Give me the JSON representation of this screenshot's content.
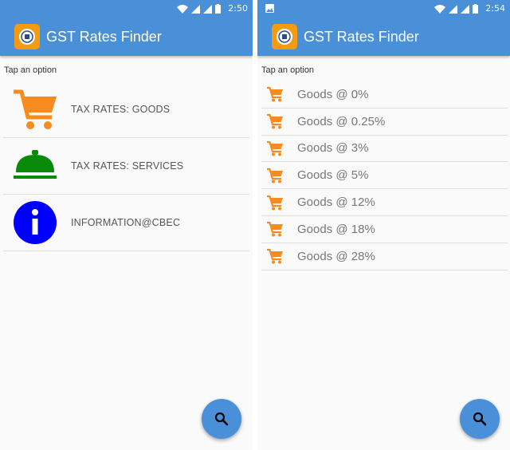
{
  "left": {
    "status_time": "2:50",
    "app_title": "GST Rates Finder",
    "hint": "Tap an option",
    "menu": [
      {
        "label": "TAX RATES: GOODS",
        "icon": "cart-icon"
      },
      {
        "label": "TAX RATES: SERVICES",
        "icon": "service-bell-icon"
      },
      {
        "label": "INFORMATION@CBEC",
        "icon": "info-icon"
      }
    ]
  },
  "right": {
    "status_time": "2:54",
    "app_title": "GST Rates Finder",
    "hint": "Tap an option",
    "rates": [
      {
        "label": "Goods @ 0%"
      },
      {
        "label": "Goods @ 0.25%"
      },
      {
        "label": "Goods @ 3%"
      },
      {
        "label": "Goods @ 5%"
      },
      {
        "label": "Goods @ 12%"
      },
      {
        "label": "Goods @ 18%"
      },
      {
        "label": "Goods @ 28%"
      }
    ]
  },
  "colors": {
    "primary": "#4a90d9",
    "cart": "#f68b1f",
    "bell": "#0a8a0a",
    "info": "#0000ff",
    "logo": "#f39c12"
  }
}
